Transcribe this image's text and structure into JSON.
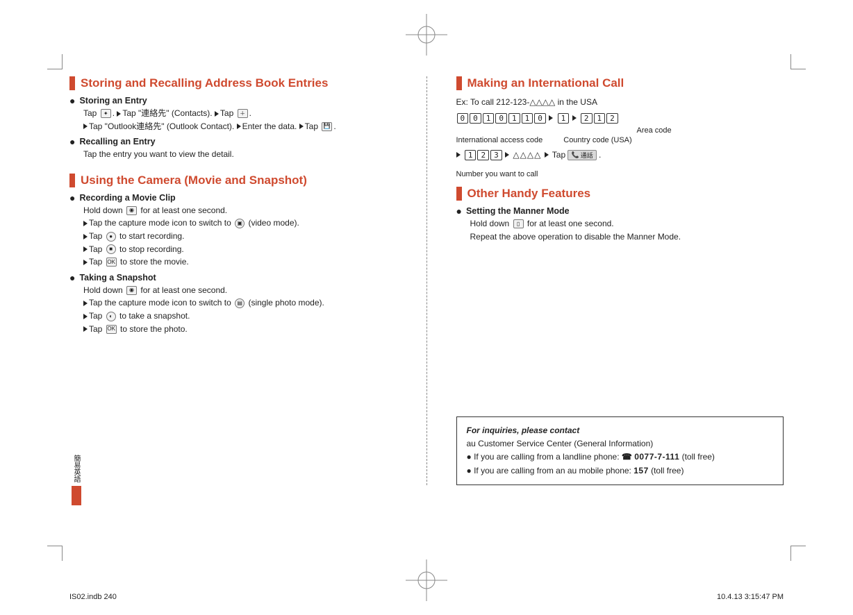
{
  "left": {
    "section1": {
      "title": "Storing and Recalling Address Book Entries",
      "items": [
        {
          "head": "Storing an Entry",
          "lines": [
            {
              "pre": "Tap ",
              "icon": "start-icon",
              "post": ". "
            },
            {
              "tri": true,
              "text": "Tap \"連絡先\" (Contacts). "
            },
            {
              "tri": true,
              "text": "Tap ",
              "icon": "new-contact-icon",
              "post": "."
            },
            {
              "br": true
            },
            {
              "tri": true,
              "text": "Tap \"Outlook連絡先\" (Outlook Contact). "
            },
            {
              "tri": true,
              "text": "Enter the data. "
            },
            {
              "tri": true,
              "text": "Tap ",
              "icon": "save-icon",
              "post": "."
            }
          ]
        },
        {
          "head": "Recalling an Entry",
          "lines": [
            {
              "text": "Tap the entry you want to view the detail."
            }
          ]
        }
      ]
    },
    "section2": {
      "title": "Using the Camera (Movie and Snapshot)",
      "items": [
        {
          "head": "Recording a Movie Clip",
          "lines": [
            {
              "text": "Hold down ",
              "icon": "camera-key-icon",
              "post": " for at least one second."
            },
            {
              "br": true
            },
            {
              "tri": true,
              "text": "Tap the capture mode icon to switch to ",
              "icon": "video-mode-icon",
              "post": " (video mode)."
            },
            {
              "br": true
            },
            {
              "tri": true,
              "text": "Tap ",
              "icon": "record-icon",
              "post": " to start recording."
            },
            {
              "br": true
            },
            {
              "tri": true,
              "text": "Tap ",
              "icon": "stop-icon",
              "post": " to stop recording."
            },
            {
              "br": true
            },
            {
              "tri": true,
              "text": "Tap ",
              "icon": "ok-icon",
              "post": " to store the movie."
            }
          ]
        },
        {
          "head": "Taking a Snapshot",
          "lines": [
            {
              "text": "Hold down ",
              "icon": "camera-key-icon",
              "post": " for at least one second."
            },
            {
              "br": true
            },
            {
              "tri": true,
              "text": "Tap the capture mode icon to switch to ",
              "icon": "photo-mode-icon",
              "post": " (single photo mode)."
            },
            {
              "br": true
            },
            {
              "tri": true,
              "text": "Tap ",
              "icon": "shutter-icon",
              "post": " to take a snapshot."
            },
            {
              "br": true
            },
            {
              "tri": true,
              "text": "Tap ",
              "icon": "ok-icon",
              "post": " to store the photo."
            }
          ]
        }
      ]
    }
  },
  "right": {
    "section1": {
      "title": "Making an International Call",
      "example": "Ex: To call 212-123-△△△△ in the USA",
      "keys1": [
        "0",
        "0",
        "1",
        "0",
        "1",
        "1",
        "0"
      ],
      "keys1b": [
        "1"
      ],
      "keys1c": [
        "2",
        "1",
        "2"
      ],
      "label_area": "Area code",
      "label_intl": "International access code",
      "label_country": "Country code (USA)",
      "keys2": [
        "1",
        "2",
        "3"
      ],
      "keys2_post": " △△△△ ",
      "tap_label": "Tap",
      "call_btn": "通話",
      "label_number": "Number you want to call"
    },
    "section2": {
      "title": "Other Handy Features",
      "items": [
        {
          "head": "Setting the Manner Mode",
          "lines": [
            {
              "text": "Hold down ",
              "icon": "manner-key-icon",
              "post": " for at least one second."
            },
            {
              "br": true
            },
            {
              "text": "Repeat the above operation to disable the Manner Mode."
            }
          ]
        }
      ]
    },
    "info": {
      "head": "For inquiries, please contact",
      "sub": "au Customer Service Center (General Information)",
      "b1_pre": "If you are calling from a landline phone: ",
      "b1_num": "0077-7-111",
      "b1_post": " (toll free)",
      "b2_pre": "If you are calling from an au mobile phone: ",
      "b2_num": "157",
      "b2_post": " (toll free)"
    }
  },
  "tab": "簡易英語",
  "footer": {
    "left": "IS02.indb   240",
    "right": "10.4.13   3:15:47 PM"
  }
}
